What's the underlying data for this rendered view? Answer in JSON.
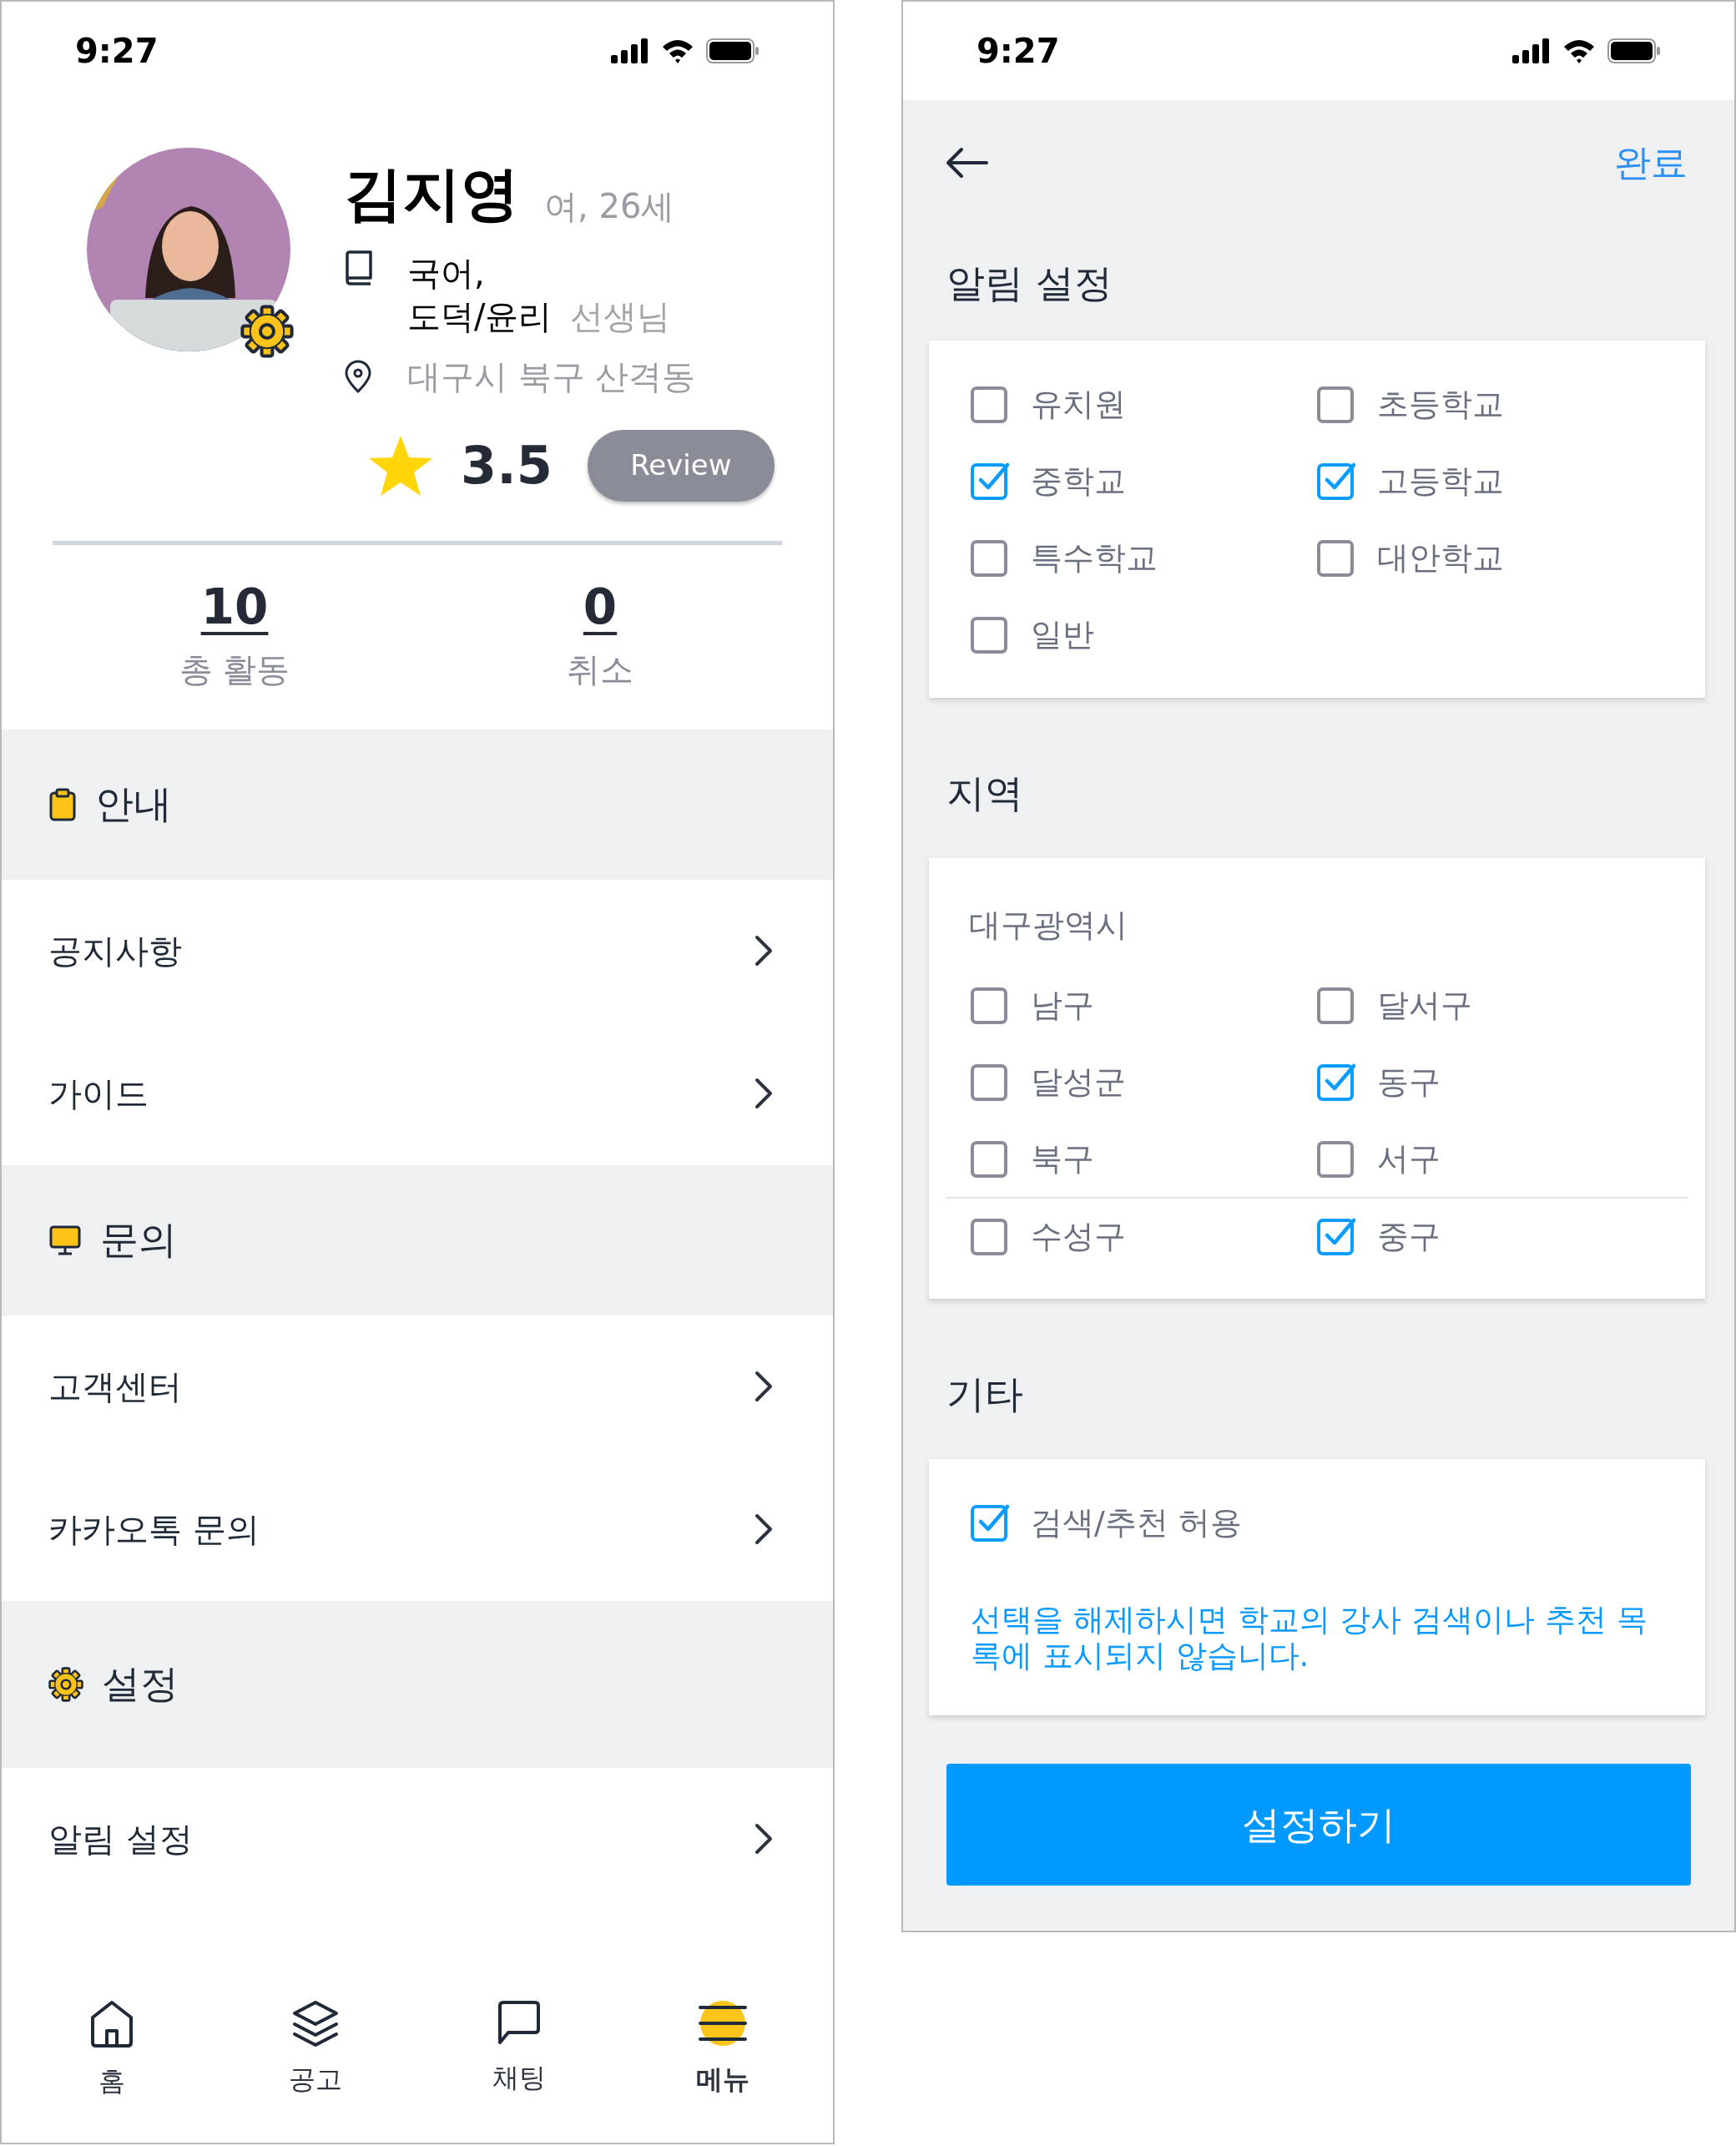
{
  "profile_screen": {
    "status_bar": {
      "time": "9:27"
    },
    "profile": {
      "name": "김지영",
      "meta": "여, 26세",
      "subjects": [
        "국어,",
        "도덕/윤리"
      ],
      "role": "선생님",
      "location": "대구시 북구 산격동",
      "rating": "3.5",
      "review_button": "Review"
    },
    "stats": [
      {
        "value": "10",
        "label": "총 활동"
      },
      {
        "value": "0",
        "label": "취소"
      }
    ],
    "sections": [
      {
        "title": "안내",
        "kind": "clipboard",
        "items": [
          "공지사항",
          "가이드"
        ]
      },
      {
        "title": "문의",
        "kind": "monitor",
        "items": [
          "고객센터",
          "카카오톡 문의"
        ]
      },
      {
        "title": "설정",
        "kind": "gear",
        "items": [
          "알림 설정"
        ]
      }
    ],
    "tab_bar": [
      {
        "label": "홈",
        "kind": "home",
        "selected": false
      },
      {
        "label": "공고",
        "kind": "layers",
        "selected": false
      },
      {
        "label": "채팅",
        "kind": "chat",
        "selected": false
      },
      {
        "label": "메뉴",
        "kind": "menu",
        "selected": true
      }
    ]
  },
  "settings_screen": {
    "status_bar": {
      "time": "9:27"
    },
    "done": "완료",
    "groups": [
      {
        "title": "알림 설정",
        "options": [
          {
            "label": "유치원",
            "checked": false
          },
          {
            "label": "초등학교",
            "checked": false
          },
          {
            "label": "중학교",
            "checked": true
          },
          {
            "label": "고등학교",
            "checked": true
          },
          {
            "label": "특수학교",
            "checked": false
          },
          {
            "label": "대안학교",
            "checked": false
          },
          {
            "label": "일반",
            "checked": false
          }
        ]
      },
      {
        "title": "지역",
        "subtitle": "대구광역시",
        "options": [
          {
            "label": "남구",
            "checked": false
          },
          {
            "label": "달서구",
            "checked": false
          },
          {
            "label": "달성군",
            "checked": false
          },
          {
            "label": "동구",
            "checked": true
          },
          {
            "label": "북구",
            "checked": false
          },
          {
            "label": "서구",
            "checked": false
          },
          {
            "label": "수성구",
            "checked": false
          },
          {
            "label": "중구",
            "checked": true
          }
        ]
      },
      {
        "title": "기타",
        "options": [
          {
            "label": "검색/추천 허용",
            "checked": true
          }
        ],
        "note": "선택을 해제하시면 학교의 강사 검색이나 추천 목록에 표시되지 않습니다."
      }
    ],
    "submit": "설정하기"
  }
}
